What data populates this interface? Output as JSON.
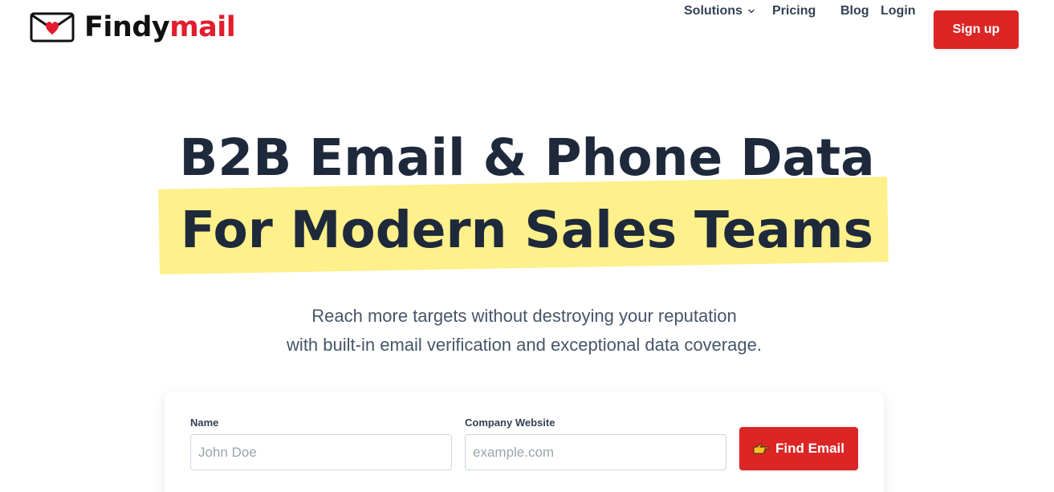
{
  "brand": {
    "name_part1": "Findy",
    "name_part2": "mail",
    "logo_icon": "envelope-heart-icon",
    "accent_color": "#e11d2e"
  },
  "nav": {
    "solutions": "Solutions",
    "pricing": "Pricing",
    "blog": "Blog",
    "login": "Login",
    "signup": "Sign up"
  },
  "hero": {
    "line1": "B2B Email & Phone Data",
    "line2": "For Modern Sales Teams",
    "highlight_color": "#fef08a",
    "subtitle_line1": "Reach more targets without destroying your reputation",
    "subtitle_line2": "with built-in email verification and exceptional data coverage."
  },
  "form": {
    "name_label": "Name",
    "name_placeholder": "John Doe",
    "company_label": "Company Website",
    "company_placeholder": "example.com",
    "submit_label": "Find Email",
    "submit_icon": "pointing-hand-icon",
    "button_color": "#dc2626"
  }
}
